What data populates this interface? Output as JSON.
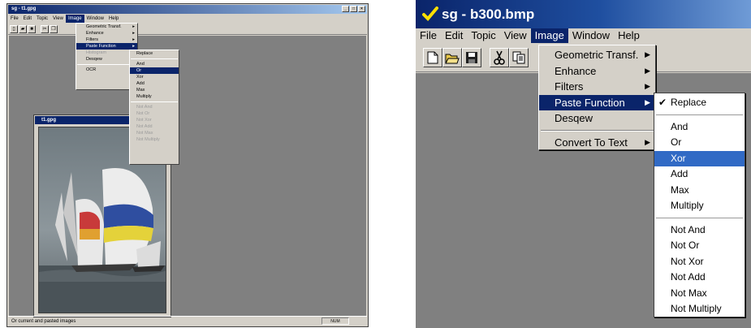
{
  "left": {
    "title": "sg - t1.gpg",
    "controls": [
      "_",
      "□",
      "×"
    ],
    "menubar": [
      "File",
      "Edit",
      "Topic",
      "View",
      "Image",
      "Window",
      "Help"
    ],
    "active_menu": "Image",
    "image_menu": [
      "Geometric Transf.",
      "Enhance",
      "Filters",
      "Paste Function",
      "Histogram",
      "Desqew",
      "OCR"
    ],
    "paste_menu": [
      "Replace",
      "And",
      "Or",
      "Xor",
      "Add",
      "Max",
      "Multiply",
      "Not And",
      "Not Or",
      "Not Xor",
      "Not Add",
      "Not Max",
      "Not Multiply"
    ],
    "child_title": "t1.gpg",
    "status_text": "Or current and pasted images",
    "status_num": "NUM"
  },
  "right": {
    "title": "sg - b300.bmp",
    "menubar": [
      "File",
      "Edit",
      "Topic",
      "View",
      "Image",
      "Window",
      "Help"
    ],
    "active_menu": "Image",
    "image_menu": {
      "geometric": "Geometric Transf.",
      "enhance": "Enhance",
      "filters": "Filters",
      "paste": "Paste Function",
      "desqew": "Desqew",
      "convert": "Convert To Text"
    },
    "paste_menu": {
      "replace": "Replace",
      "and": "And",
      "or": "Or",
      "xor": "Xor",
      "add": "Add",
      "max": "Max",
      "multiply": "Multiply",
      "not_and": "Not And",
      "not_or": "Not Or",
      "not_xor": "Not Xor",
      "not_add": "Not Add",
      "not_max": "Not Max",
      "not_multiply": "Not Multiply"
    }
  },
  "colors": {
    "window_face": "#d4d0c8",
    "titlebar": "#0a246a",
    "menu_highlight": "#316ac5",
    "workspace": "#808080"
  }
}
